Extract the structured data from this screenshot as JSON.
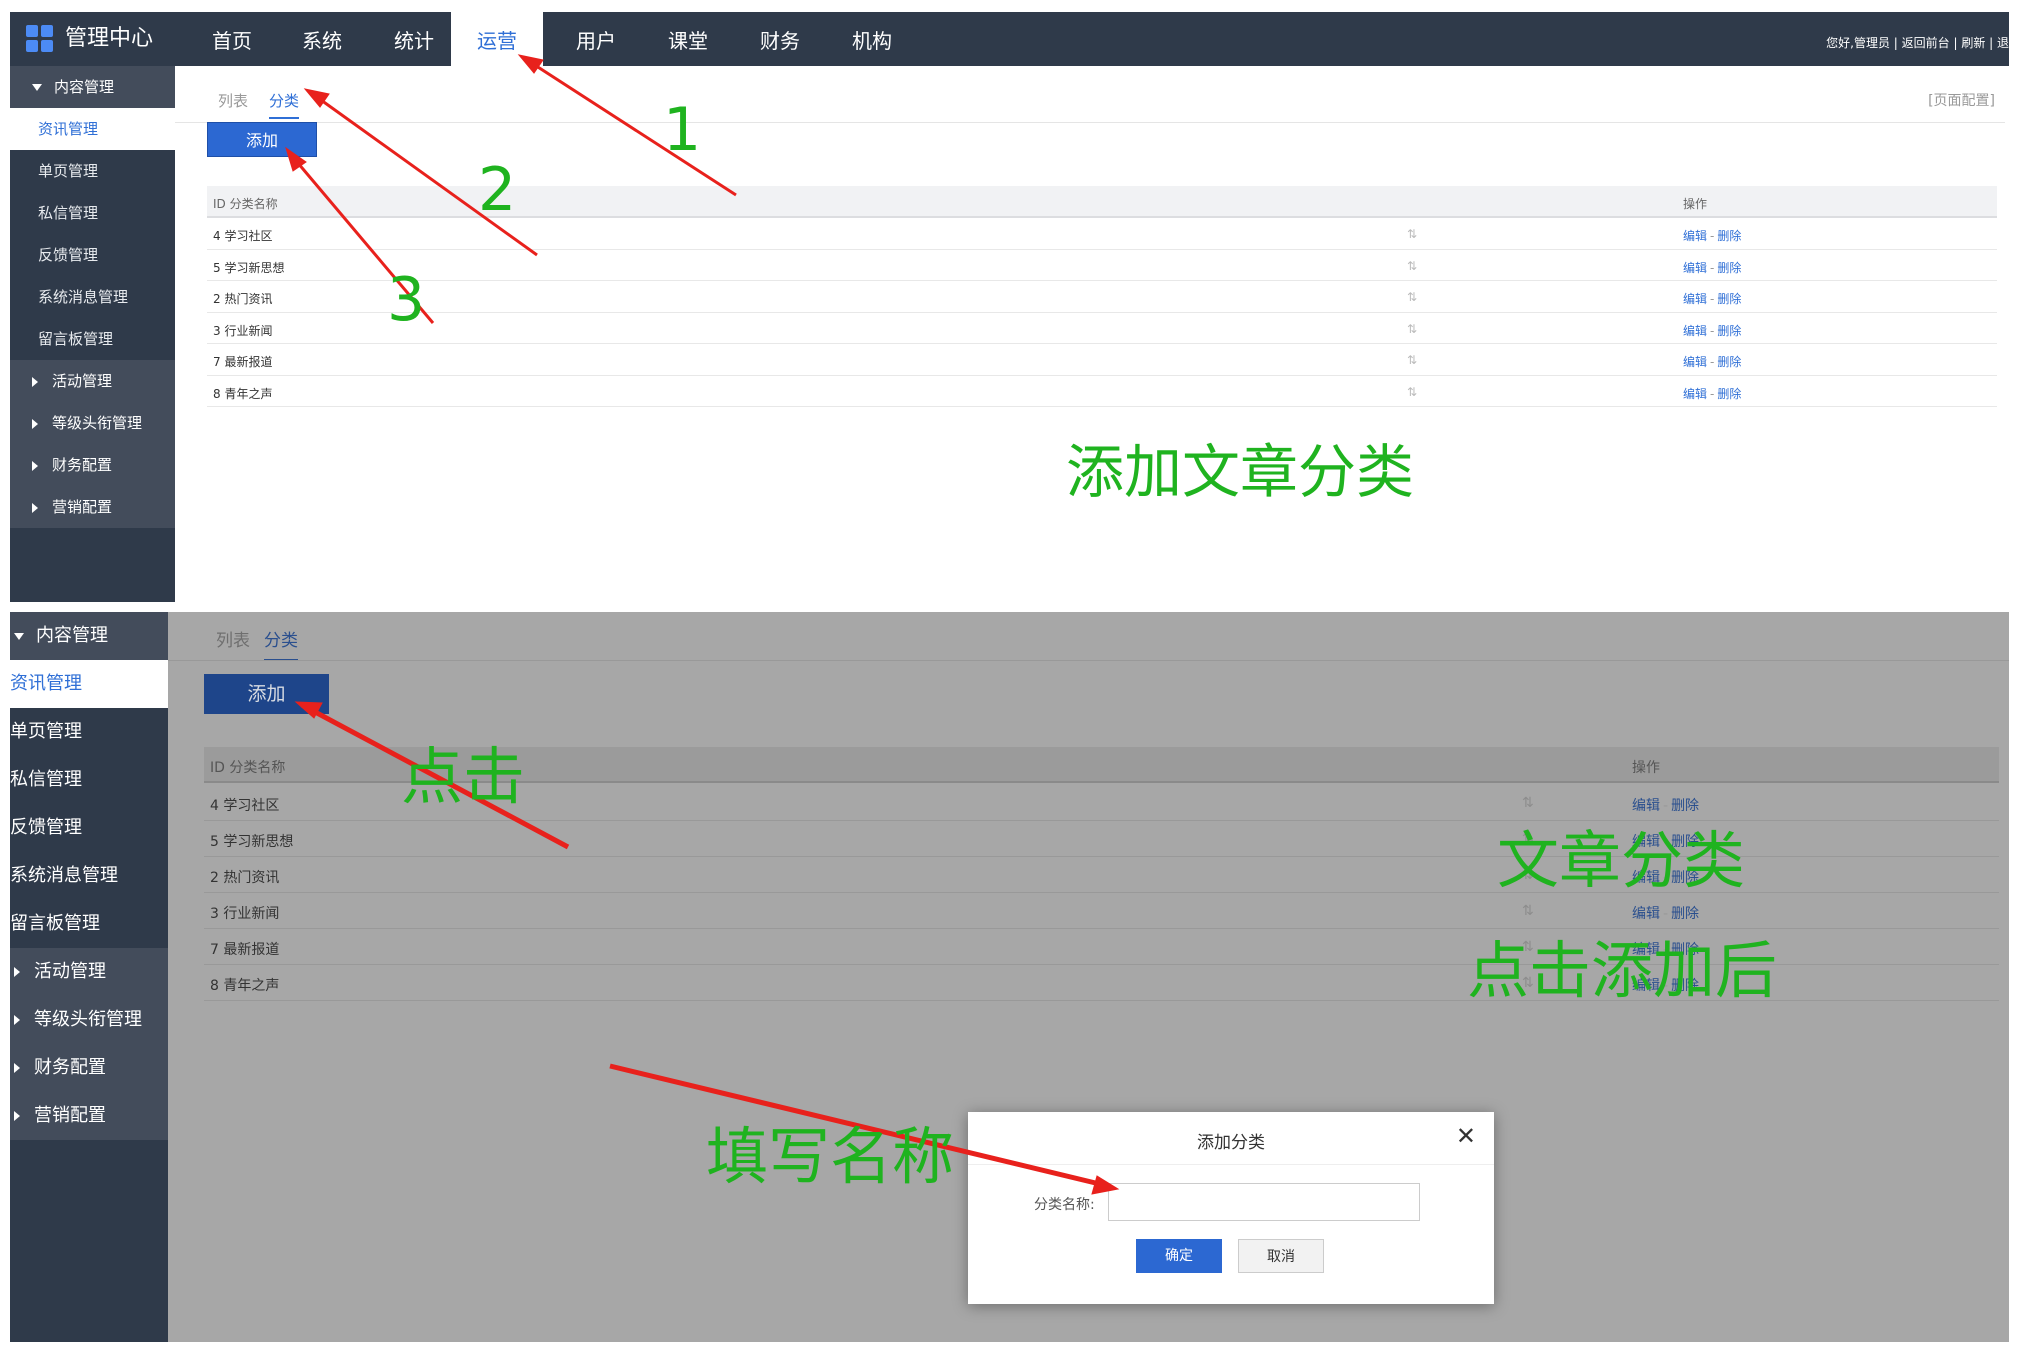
{
  "app": {
    "title": "管理中心",
    "logo_icon": "grid-logo-icon"
  },
  "topnav": {
    "items": [
      {
        "label": "首页"
      },
      {
        "label": "系统"
      },
      {
        "label": "统计"
      },
      {
        "label": "运营"
      },
      {
        "label": "用户"
      },
      {
        "label": "课堂"
      },
      {
        "label": "财务"
      },
      {
        "label": "机构"
      }
    ],
    "active": "运营",
    "right_text": "您好,管理员 | 返回前台 | 刷新 | 退"
  },
  "sidebar": {
    "group_content": "内容管理",
    "items": [
      "资讯管理",
      "单页管理",
      "私信管理",
      "反馈管理",
      "系统消息管理",
      "留言板管理"
    ],
    "groups": [
      "活动管理",
      "等级头衔管理",
      "财务配置",
      "营销配置"
    ]
  },
  "tabs": {
    "list": "列表",
    "category": "分类"
  },
  "page_config": "[页面配置]",
  "add_button": "添加",
  "table": {
    "col_id_name": "ID 分类名称",
    "col_ops": "操作",
    "rows": [
      {
        "text": "4 学习社区"
      },
      {
        "text": "5 学习新思想"
      },
      {
        "text": "2 热门资讯"
      },
      {
        "text": "3 行业新闻"
      },
      {
        "text": "7 最新报道"
      },
      {
        "text": "8 青年之声"
      }
    ],
    "sort_glyph": "⇅",
    "op_edit": "编辑",
    "op_sep": "-",
    "op_delete": "删除"
  },
  "dialog": {
    "title": "添加分类",
    "field_label": "分类名称:",
    "field_value": "",
    "confirm": "确定",
    "cancel": "取消",
    "close_icon": "close-icon"
  },
  "annotations": {
    "n1": "1",
    "n2": "2",
    "n3": "3",
    "caption_top": "添加文章分类",
    "click": "点击",
    "caption_bottom_1": "文章分类",
    "caption_bottom_2": "点击添加后",
    "fill_name": "填写名称",
    "color_green": "#1fb31f",
    "color_arrow": "#e8211c"
  }
}
